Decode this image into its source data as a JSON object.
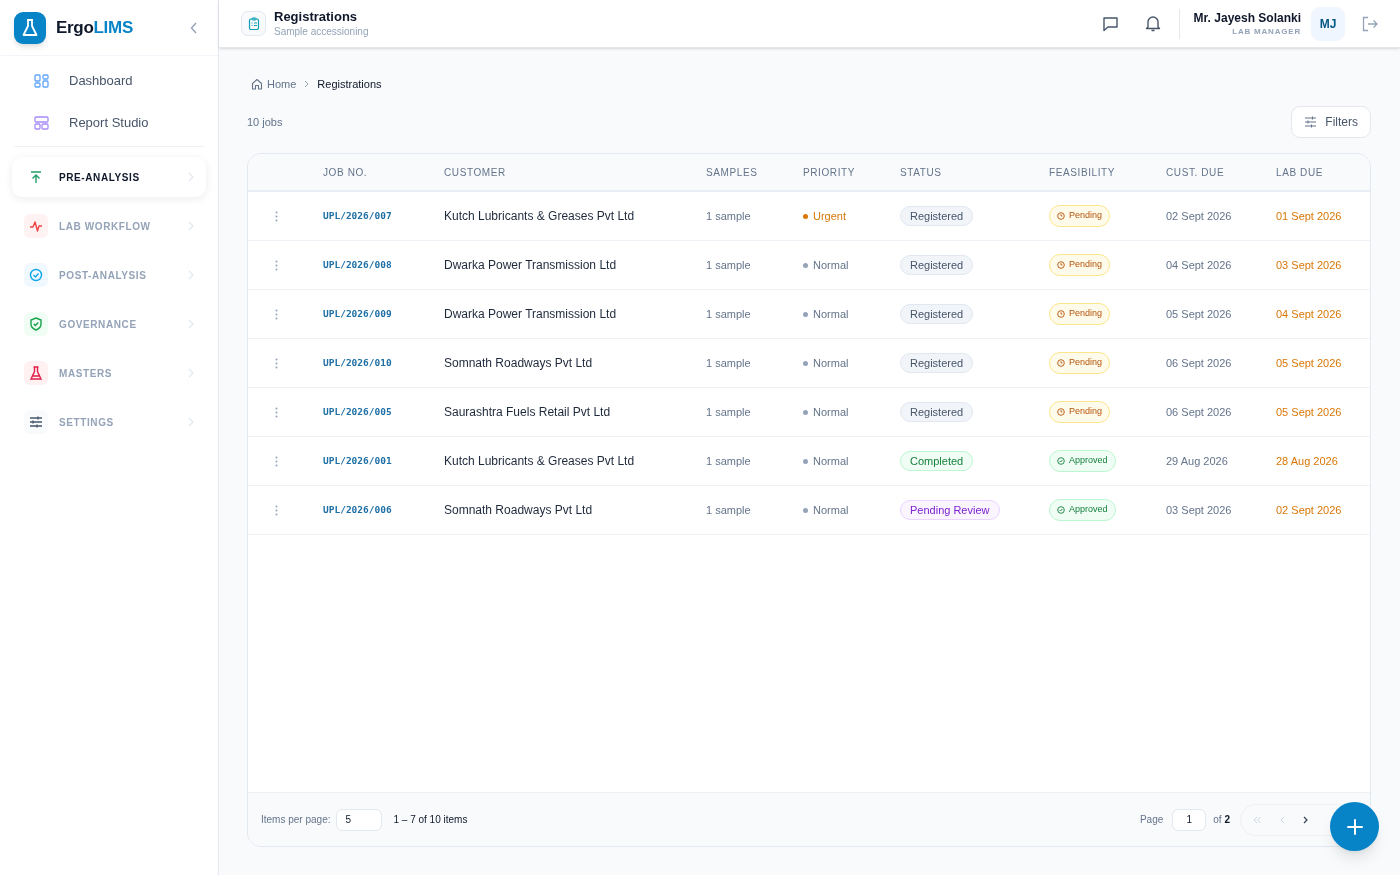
{
  "brand": {
    "name_start": "Ergo",
    "name_end": "LIMS"
  },
  "nav_links": [
    {
      "label": "Dashboard"
    },
    {
      "label": "Report Studio"
    }
  ],
  "nav_sections": [
    {
      "label": "PRE-ANALYSIS",
      "selected": true
    },
    {
      "label": "LAB WORKFLOW",
      "selected": false
    },
    {
      "label": "POST-ANALYSIS",
      "selected": false
    },
    {
      "label": "GOVERNANCE",
      "selected": false
    },
    {
      "label": "MASTERS",
      "selected": false
    },
    {
      "label": "SETTINGS",
      "selected": false
    }
  ],
  "header": {
    "title": "Registrations",
    "subtitle": "Sample accessioning"
  },
  "user": {
    "name": "Mr. Jayesh Solanki",
    "role": "LAB MANAGER",
    "initials": "MJ"
  },
  "breadcrumb": [
    "Home",
    "Registrations"
  ],
  "job_count": "10 jobs",
  "filters_button": "Filters",
  "table": {
    "columns": [
      "JOB NO.",
      "CUSTOMER",
      "SAMPLES",
      "PRIORITY",
      "STATUS",
      "FEASIBILITY",
      "CUST. DUE",
      "LAB DUE"
    ],
    "rows": [
      {
        "job": "UPL/2026/007",
        "customer": "Kutch Lubricants & Greases Pvt Ltd",
        "samples": "1 sample",
        "priority": {
          "kind": "urgent",
          "label": "Urgent"
        },
        "status": {
          "kind": "registered",
          "label": "Registered"
        },
        "feasibility": {
          "kind": "pending",
          "label": "Pending"
        },
        "cust_due": "02 Sept 2026",
        "lab_due": "01 Sept 2026"
      },
      {
        "job": "UPL/2026/008",
        "customer": "Dwarka Power Transmission Ltd",
        "samples": "1 sample",
        "priority": {
          "kind": "normal",
          "label": "Normal"
        },
        "status": {
          "kind": "registered",
          "label": "Registered"
        },
        "feasibility": {
          "kind": "pending",
          "label": "Pending"
        },
        "cust_due": "04 Sept 2026",
        "lab_due": "03 Sept 2026"
      },
      {
        "job": "UPL/2026/009",
        "customer": "Dwarka Power Transmission Ltd",
        "samples": "1 sample",
        "priority": {
          "kind": "normal",
          "label": "Normal"
        },
        "status": {
          "kind": "registered",
          "label": "Registered"
        },
        "feasibility": {
          "kind": "pending",
          "label": "Pending"
        },
        "cust_due": "05 Sept 2026",
        "lab_due": "04 Sept 2026"
      },
      {
        "job": "UPL/2026/010",
        "customer": "Somnath Roadways Pvt Ltd",
        "samples": "1 sample",
        "priority": {
          "kind": "normal",
          "label": "Normal"
        },
        "status": {
          "kind": "registered",
          "label": "Registered"
        },
        "feasibility": {
          "kind": "pending",
          "label": "Pending"
        },
        "cust_due": "06 Sept 2026",
        "lab_due": "05 Sept 2026"
      },
      {
        "job": "UPL/2026/005",
        "customer": "Saurashtra Fuels Retail Pvt Ltd",
        "samples": "1 sample",
        "priority": {
          "kind": "normal",
          "label": "Normal"
        },
        "status": {
          "kind": "registered",
          "label": "Registered"
        },
        "feasibility": {
          "kind": "pending",
          "label": "Pending"
        },
        "cust_due": "06 Sept 2026",
        "lab_due": "05 Sept 2026"
      },
      {
        "job": "UPL/2026/001",
        "customer": "Kutch Lubricants & Greases Pvt Ltd",
        "samples": "1 sample",
        "priority": {
          "kind": "normal",
          "label": "Normal"
        },
        "status": {
          "kind": "completed",
          "label": "Completed"
        },
        "feasibility": {
          "kind": "approved",
          "label": "Approved"
        },
        "cust_due": "29 Aug 2026",
        "lab_due": "28 Aug 2026"
      },
      {
        "job": "UPL/2026/006",
        "customer": "Somnath Roadways Pvt Ltd",
        "samples": "1 sample",
        "priority": {
          "kind": "normal",
          "label": "Normal"
        },
        "status": {
          "kind": "pending_review",
          "label": "Pending Review"
        },
        "feasibility": {
          "kind": "approved",
          "label": "Approved"
        },
        "cust_due": "03 Sept 2026",
        "lab_due": "02 Sept 2026"
      }
    ]
  },
  "pagination": {
    "items_per_page_label": "Items per page:",
    "items_per_page": "5",
    "range": "1 – 7 of 10 items",
    "page_label": "Page",
    "page": "1",
    "of_label": "of",
    "total_pages": "2"
  }
}
